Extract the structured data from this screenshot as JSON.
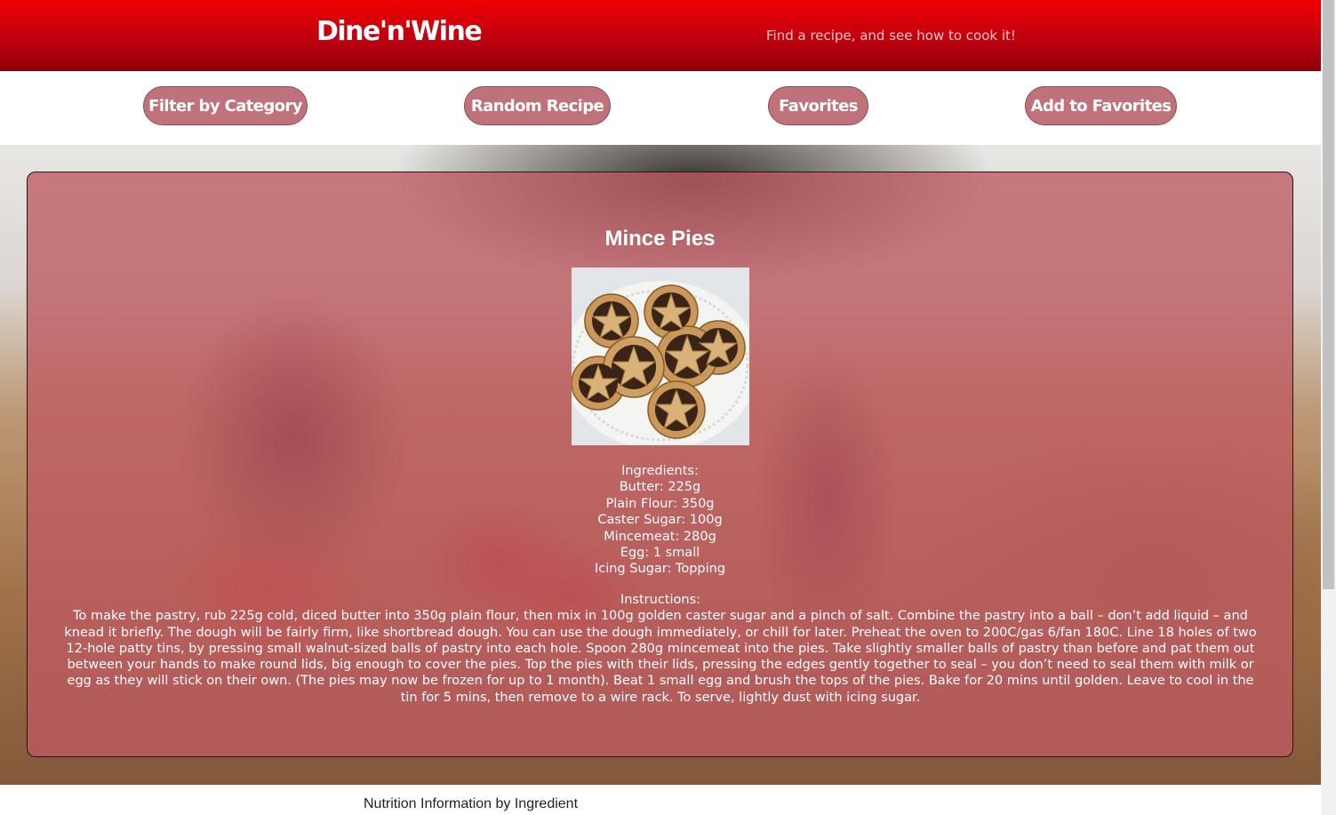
{
  "header": {
    "brand": "Dine'n'Wine",
    "tagline": "Find a recipe, and see how to cook it!"
  },
  "nav": {
    "filter_label": "Filter by Category",
    "random_label": "Random Recipe",
    "favorites_label": "Favorites",
    "add_favorites_label": "Add to Favorites"
  },
  "recipe": {
    "title": "Mince Pies",
    "ingredients_heading": "Ingredients:",
    "ingredients": [
      "Butter: 225g",
      "Plain Flour: 350g",
      "Caster Sugar: 100g",
      "Mincemeat: 280g",
      "Egg: 1 small",
      "Icing Sugar: Topping"
    ],
    "instructions_heading": "Instructions:",
    "instructions": "To make the pastry, rub 225g cold, diced butter into 350g plain flour, then mix in 100g golden caster sugar and a pinch of salt. Combine the pastry into a ball – don’t add liquid – and knead it briefly. The dough will be fairly firm, like shortbread dough. You can use the dough immediately, or chill for later. Preheat the oven to 200C/gas 6/fan 180C. Line 18 holes of two 12-hole patty tins, by pressing small walnut-sized balls of pastry into each hole. Spoon 280g mincemeat into the pies. Take slightly smaller balls of pastry than before and pat them out between your hands to make round lids, big enough to cover the pies. Top the pies with their lids, pressing the edges gently together to seal – you don’t need to seal them with milk or egg as they will stick on their own. (The pies may now be frozen for up to 1 month). Beat 1 small egg and brush the tops of the pies. Bake for 20 mins until golden. Leave to cool in the tin for 5 mins, then remove to a wire rack. To serve, lightly dust with icing sugar."
  },
  "nutrition": {
    "title": "Nutrition Information by Ingredient"
  },
  "colors": {
    "header_red": "#e00000",
    "button_fill": "#c0727a",
    "card_overlay": "#be5a62"
  }
}
